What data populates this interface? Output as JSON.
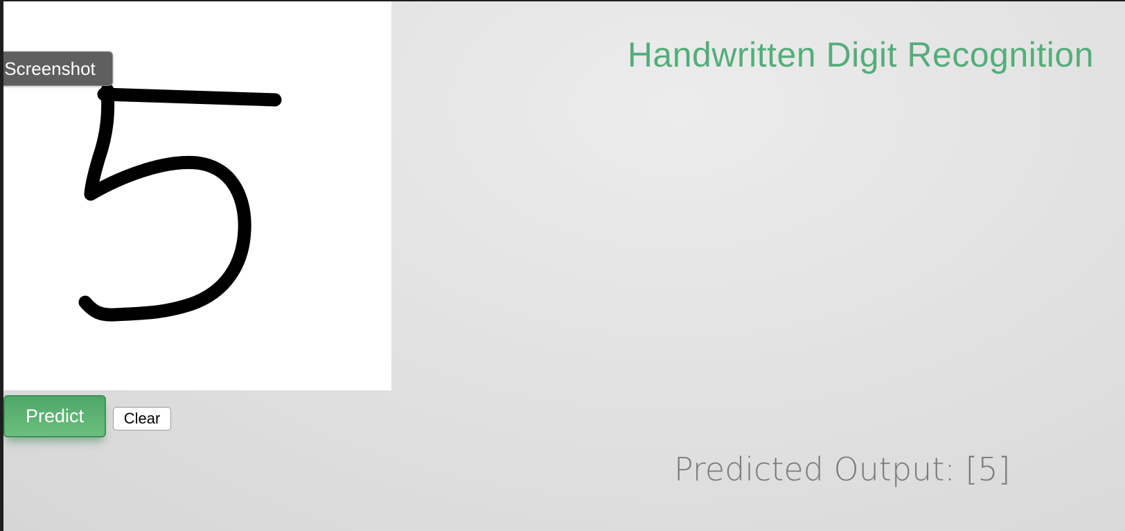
{
  "app": {
    "title": "Handwritten Digit Recognition"
  },
  "canvas": {
    "background": "#ffffff",
    "stroke_color": "#000000",
    "drawn_digit": "5"
  },
  "toolbar": {
    "screenshot_label": "Screenshot",
    "predict_label": "Predict",
    "clear_label": "Clear"
  },
  "result": {
    "output_text": "Predicted Output: [5]"
  },
  "colors": {
    "accent": "#54ad7a",
    "predict_button": "#5bb36f"
  }
}
